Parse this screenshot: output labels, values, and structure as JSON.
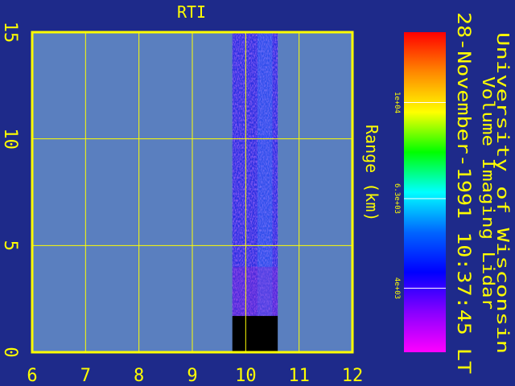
{
  "chart_data": {
    "type": "heatmap",
    "title": "RTI",
    "ylabel": "Range (km)",
    "xlim": [
      6,
      12
    ],
    "ylim": [
      0,
      15
    ],
    "xticks": [
      "6",
      "7",
      "8",
      "9",
      "10",
      "11",
      "12"
    ],
    "yticks": [
      "0",
      "5",
      "10",
      "15"
    ],
    "grid": true,
    "data_region": {
      "x_start": 9.75,
      "x_end": 10.6,
      "no_data_top": 1.7,
      "signal_top": 15
    },
    "colorbar": {
      "scale": "log",
      "tick_labels": [
        "1e+04",
        "6.3e+03",
        "4e+03"
      ],
      "tick_fractions": [
        0.22,
        0.52,
        0.8
      ],
      "colors": [
        "#ff0000",
        "#ff8800",
        "#ffff00",
        "#00ff00",
        "#00ffff",
        "#0066ff",
        "#0000ff",
        "#8800ff",
        "#ff00ff"
      ]
    },
    "annotations": [
      "University of Wisconsin",
      "Volume Imaging Lidar",
      "28-November-1991 10:37:45 LT"
    ]
  },
  "colors": {
    "background": "#1e2a8a",
    "plot_area": "#5a7fbf",
    "axis": "#ffff00",
    "text": "#ffff00",
    "no_data": "#000000"
  }
}
